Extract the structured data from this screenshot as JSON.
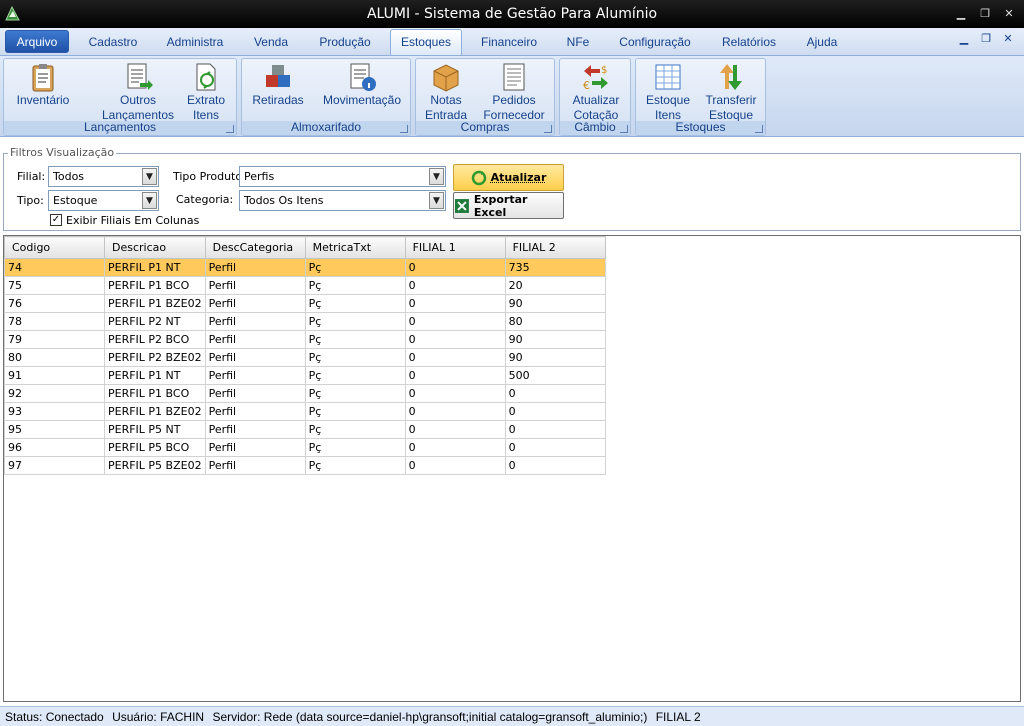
{
  "window": {
    "title": "ALUMI - Sistema de Gestão Para Alumínio"
  },
  "menu": {
    "tabs": [
      "Arquivo",
      "Cadastro",
      "Administra",
      "Venda",
      "Produção",
      "Estoques",
      "Financeiro",
      "NFe",
      "Configuração",
      "Relatórios",
      "Ajuda"
    ],
    "active": "Estoques"
  },
  "ribbon": {
    "groups": [
      {
        "label": "Lançamentos",
        "buttons": [
          {
            "label": "Inventário",
            "icon": "clipboard-icon"
          },
          {
            "label": "Outros\nLançamentos",
            "icon": "document-arrow-icon"
          },
          {
            "label": "Extrato\nItens",
            "icon": "statement-icon"
          }
        ]
      },
      {
        "label": "Almoxarifado",
        "buttons": [
          {
            "label": "Retiradas",
            "icon": "boxes-icon"
          },
          {
            "label": "Movimentação",
            "icon": "document-info-icon"
          }
        ]
      },
      {
        "label": "Compras",
        "buttons": [
          {
            "label": "Notas\nEntrada",
            "icon": "package-icon"
          },
          {
            "label": "Pedidos\nFornecedor",
            "icon": "order-sheet-icon"
          }
        ]
      },
      {
        "label": "Câmbio",
        "buttons": [
          {
            "label": "Atualizar\nCotação",
            "icon": "currency-exchange-icon"
          }
        ]
      },
      {
        "label": "Estoques",
        "buttons": [
          {
            "label": "Estoque\nItens",
            "icon": "spreadsheet-icon"
          },
          {
            "label": "Transferir\nEstoque",
            "icon": "transfer-arrows-icon"
          }
        ]
      }
    ]
  },
  "filters": {
    "legend": "Filtros Visualização",
    "filial_label": "Filial:",
    "filial_value": "Todos",
    "tipo_label": "Tipo:",
    "tipo_value": "Estoque",
    "tipo_produto_label": "Tipo Produto:",
    "tipo_produto_value": "Perfis",
    "categoria_label": "Categoria:",
    "categoria_value": "Todos Os Itens",
    "exibir_filiais_label": "Exibir Filiais Em Colunas",
    "exibir_filiais_checked": true,
    "atualizar_label": "Atualizar",
    "exportar_label": "Exportar Excel"
  },
  "grid": {
    "columns": [
      "Codigo",
      "Descricao",
      "DescCategoria",
      "MetricaTxt",
      "FILIAL 1",
      "FILIAL 2"
    ],
    "rows": [
      [
        "74",
        "PERFIL P1 NT",
        "Perfil",
        "Pç",
        "0",
        "735"
      ],
      [
        "75",
        "PERFIL P1 BCO",
        "Perfil",
        "Pç",
        "0",
        "20"
      ],
      [
        "76",
        "PERFIL P1 BZE02",
        "Perfil",
        "Pç",
        "0",
        "90"
      ],
      [
        "78",
        "PERFIL P2 NT",
        "Perfil",
        "Pç",
        "0",
        "80"
      ],
      [
        "79",
        "PERFIL P2 BCO",
        "Perfil",
        "Pç",
        "0",
        "90"
      ],
      [
        "80",
        "PERFIL P2 BZE02",
        "Perfil",
        "Pç",
        "0",
        "90"
      ],
      [
        "91",
        "PERFIL P1 NT",
        "Perfil",
        "Pç",
        "0",
        "500"
      ],
      [
        "92",
        "PERFIL P1 BCO",
        "Perfil",
        "Pç",
        "0",
        "0"
      ],
      [
        "93",
        "PERFIL P1 BZE02",
        "Perfil",
        "Pç",
        "0",
        "0"
      ],
      [
        "95",
        "PERFIL P5 NT",
        "Perfil",
        "Pç",
        "0",
        "0"
      ],
      [
        "96",
        "PERFIL P5 BCO",
        "Perfil",
        "Pç",
        "0",
        "0"
      ],
      [
        "97",
        "PERFIL P5 BZE02",
        "Perfil",
        "Pç",
        "0",
        "0"
      ]
    ],
    "selected_row": 0
  },
  "status": {
    "status": "Status: Conectado",
    "usuario": "Usuário: FACHIN",
    "servidor": "Servidor: Rede (data source=daniel-hp\\gransoft;initial catalog=gransoft_aluminio;)",
    "filial": "FILIAL 2"
  }
}
